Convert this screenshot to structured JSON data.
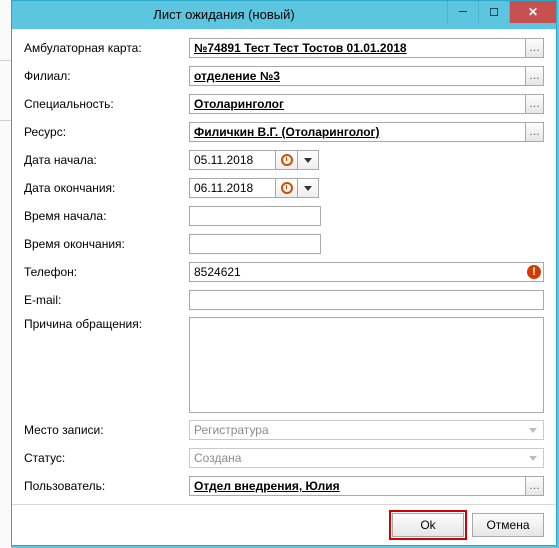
{
  "window": {
    "title": "Лист ожидания (новый)",
    "minimize_glyph": "─",
    "maximize_glyph": "☐",
    "close_glyph": "✕"
  },
  "labels": {
    "card": "Амбулаторная карта:",
    "branch": "Филиал:",
    "specialty": "Специальность:",
    "resource": "Ресурс:",
    "date_start": "Дата начала:",
    "date_end": "Дата окончания:",
    "time_start": "Время начала:",
    "time_end": "Время окончания:",
    "phone": "Телефон:",
    "email": "E-mail:",
    "reason": "Причина обращения:",
    "place": "Место записи:",
    "status": "Статус:",
    "user": "Пользователь:"
  },
  "values": {
    "card": "№74891 Тест Тест Тостов 01.01.2018",
    "branch": "отделение №3",
    "specialty": "Отоларинголог",
    "resource": "Филичкин В.Г. (Отоларинголог)",
    "date_start": "05.11.2018",
    "date_end": "06.11.2018",
    "time_start": "",
    "time_end": "",
    "phone": "8524621",
    "email": "",
    "reason": "",
    "place": "Регистратура",
    "status": "Создана",
    "user": "Отдел внедрения, Юлия"
  },
  "glyphs": {
    "ellipsis": "…",
    "error": "!"
  },
  "buttons": {
    "ok": "Ok",
    "cancel": "Отмена"
  }
}
